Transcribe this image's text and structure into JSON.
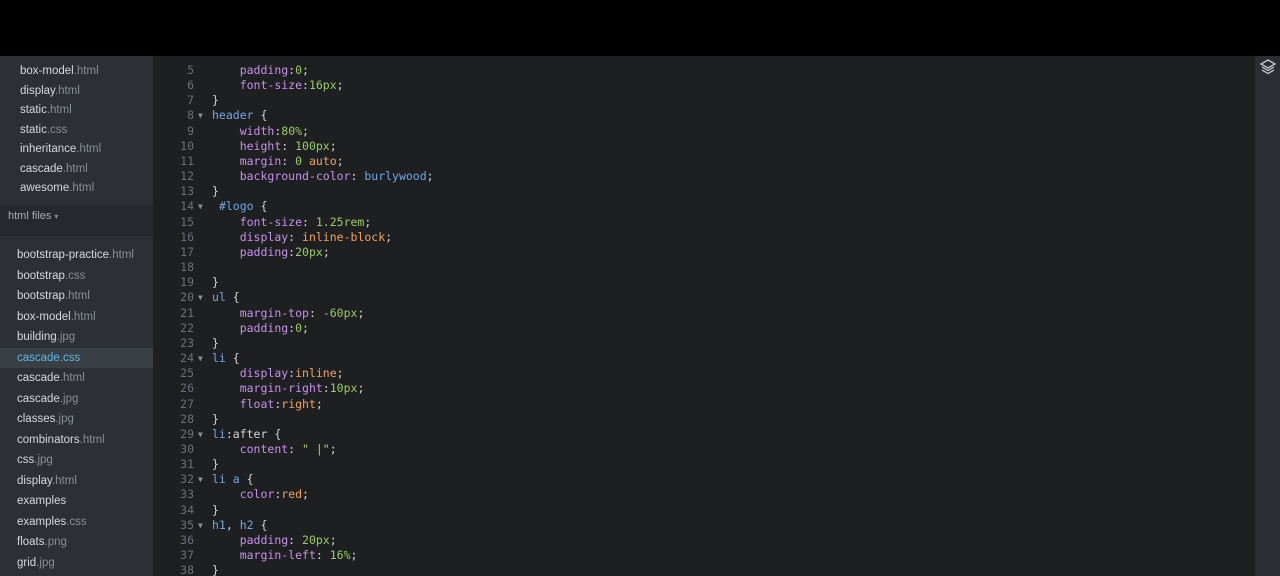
{
  "sidebar": {
    "group1": [
      {
        "name": "box-model",
        "ext": ".html"
      },
      {
        "name": "display",
        "ext": ".html"
      },
      {
        "name": "static",
        "ext": ".html"
      },
      {
        "name": "static",
        "ext": ".css"
      },
      {
        "name": "inheritance",
        "ext": ".html"
      },
      {
        "name": "cascade",
        "ext": ".html"
      },
      {
        "name": "awesome",
        "ext": ".html"
      }
    ],
    "header": "html files",
    "group2": [
      {
        "name": "bootstrap-practice",
        "ext": ".html"
      },
      {
        "name": "bootstrap",
        "ext": ".css"
      },
      {
        "name": "bootstrap",
        "ext": ".html"
      },
      {
        "name": "box-model",
        "ext": ".html"
      },
      {
        "name": "building",
        "ext": ".jpg"
      },
      {
        "name": "cascade",
        "ext": ".css"
      },
      {
        "name": "cascade",
        "ext": ".html"
      },
      {
        "name": "cascade",
        "ext": ".jpg"
      },
      {
        "name": "classes",
        "ext": ".jpg"
      },
      {
        "name": "combinators",
        "ext": ".html"
      },
      {
        "name": "css",
        "ext": ".jpg"
      },
      {
        "name": "display",
        "ext": ".html"
      },
      {
        "name": "examples",
        "ext": ""
      },
      {
        "name": "examples",
        "ext": ".css"
      },
      {
        "name": "floats",
        "ext": ".png"
      },
      {
        "name": "grid",
        "ext": ".jpg"
      }
    ],
    "selected_index": 5
  },
  "editor": {
    "lines": [
      {
        "n": "5",
        "fold": "",
        "tokens": [
          [
            "    ",
            ""
          ],
          [
            "padding",
            "prop"
          ],
          [
            ":",
            "punct"
          ],
          [
            "0",
            "num"
          ],
          [
            ";",
            "punct"
          ]
        ]
      },
      {
        "n": "6",
        "fold": "",
        "tokens": [
          [
            "    ",
            ""
          ],
          [
            "font-size",
            "prop"
          ],
          [
            ":",
            "punct"
          ],
          [
            "16px",
            "num"
          ],
          [
            ";",
            "punct"
          ]
        ]
      },
      {
        "n": "7",
        "fold": "",
        "tokens": [
          [
            "}",
            "punct"
          ]
        ]
      },
      {
        "n": "8",
        "fold": "▼",
        "tokens": [
          [
            "header",
            "sel"
          ],
          [
            " {",
            "punct"
          ]
        ]
      },
      {
        "n": "9",
        "fold": "",
        "tokens": [
          [
            "    ",
            ""
          ],
          [
            "width",
            "prop"
          ],
          [
            ":",
            "punct"
          ],
          [
            "80%",
            "num"
          ],
          [
            ";",
            "punct"
          ]
        ]
      },
      {
        "n": "10",
        "fold": "",
        "tokens": [
          [
            "    ",
            ""
          ],
          [
            "height",
            "prop"
          ],
          [
            ": ",
            "punct"
          ],
          [
            "100px",
            "num"
          ],
          [
            ";",
            "punct"
          ]
        ]
      },
      {
        "n": "11",
        "fold": "",
        "tokens": [
          [
            "    ",
            ""
          ],
          [
            "margin",
            "prop"
          ],
          [
            ": ",
            "punct"
          ],
          [
            "0",
            "num"
          ],
          [
            " ",
            ""
          ],
          [
            "auto",
            "val"
          ],
          [
            ";",
            "punct"
          ]
        ]
      },
      {
        "n": "12",
        "fold": "",
        "tokens": [
          [
            "    ",
            ""
          ],
          [
            "background-color",
            "prop"
          ],
          [
            ": ",
            "punct"
          ],
          [
            "burlywood",
            "sel"
          ],
          [
            ";",
            "punct"
          ]
        ]
      },
      {
        "n": "13",
        "fold": "",
        "tokens": [
          [
            "}",
            "punct"
          ]
        ]
      },
      {
        "n": "14",
        "fold": "▼",
        "tokens": [
          [
            " ",
            ""
          ],
          [
            "#logo",
            "id"
          ],
          [
            " {",
            "punct"
          ]
        ]
      },
      {
        "n": "15",
        "fold": "",
        "tokens": [
          [
            "    ",
            ""
          ],
          [
            "font-size",
            "prop"
          ],
          [
            ": ",
            "punct"
          ],
          [
            "1.25rem",
            "num"
          ],
          [
            ";",
            "punct"
          ]
        ]
      },
      {
        "n": "16",
        "fold": "",
        "tokens": [
          [
            "    ",
            ""
          ],
          [
            "display",
            "prop"
          ],
          [
            ": ",
            "punct"
          ],
          [
            "inline-block",
            "val"
          ],
          [
            ";",
            "punct"
          ]
        ]
      },
      {
        "n": "17",
        "fold": "",
        "tokens": [
          [
            "    ",
            ""
          ],
          [
            "padding",
            "prop"
          ],
          [
            ":",
            "punct"
          ],
          [
            "20px",
            "num"
          ],
          [
            ";",
            "punct"
          ]
        ]
      },
      {
        "n": "18",
        "fold": "",
        "tokens": []
      },
      {
        "n": "19",
        "fold": "",
        "tokens": [
          [
            "}",
            "punct"
          ]
        ]
      },
      {
        "n": "20",
        "fold": "▼",
        "tokens": [
          [
            "ul",
            "sel"
          ],
          [
            " {",
            "punct"
          ]
        ]
      },
      {
        "n": "21",
        "fold": "",
        "tokens": [
          [
            "    ",
            ""
          ],
          [
            "margin-top",
            "prop"
          ],
          [
            ": ",
            "punct"
          ],
          [
            "-60px",
            "num"
          ],
          [
            ";",
            "punct"
          ]
        ]
      },
      {
        "n": "22",
        "fold": "",
        "tokens": [
          [
            "    ",
            ""
          ],
          [
            "padding",
            "prop"
          ],
          [
            ":",
            "punct"
          ],
          [
            "0",
            "num"
          ],
          [
            ";",
            "punct"
          ]
        ]
      },
      {
        "n": "23",
        "fold": "",
        "tokens": [
          [
            "}",
            "punct"
          ]
        ]
      },
      {
        "n": "24",
        "fold": "▼",
        "tokens": [
          [
            "li",
            "sel"
          ],
          [
            " {",
            "punct"
          ]
        ]
      },
      {
        "n": "25",
        "fold": "",
        "tokens": [
          [
            "    ",
            ""
          ],
          [
            "display",
            "prop"
          ],
          [
            ":",
            "punct"
          ],
          [
            "inline",
            "val"
          ],
          [
            ";",
            "punct"
          ]
        ]
      },
      {
        "n": "26",
        "fold": "",
        "tokens": [
          [
            "    ",
            ""
          ],
          [
            "margin-right",
            "prop"
          ],
          [
            ":",
            "punct"
          ],
          [
            "10px",
            "num"
          ],
          [
            ";",
            "punct"
          ]
        ]
      },
      {
        "n": "27",
        "fold": "",
        "tokens": [
          [
            "    ",
            ""
          ],
          [
            "float",
            "prop"
          ],
          [
            ":",
            "punct"
          ],
          [
            "right",
            "val"
          ],
          [
            ";",
            "punct"
          ]
        ]
      },
      {
        "n": "28",
        "fold": "",
        "tokens": [
          [
            "}",
            "punct"
          ]
        ]
      },
      {
        "n": "29",
        "fold": "▼",
        "tokens": [
          [
            "li",
            "sel"
          ],
          [
            ":after {",
            "punct"
          ]
        ]
      },
      {
        "n": "30",
        "fold": "",
        "tokens": [
          [
            "    ",
            ""
          ],
          [
            "content",
            "prop"
          ],
          [
            ": ",
            "punct"
          ],
          [
            "\" |\"",
            "str"
          ],
          [
            ";",
            "punct"
          ]
        ]
      },
      {
        "n": "31",
        "fold": "",
        "tokens": [
          [
            "}",
            "punct"
          ]
        ]
      },
      {
        "n": "32",
        "fold": "▼",
        "tokens": [
          [
            "li a",
            "sel"
          ],
          [
            " {",
            "punct"
          ]
        ]
      },
      {
        "n": "33",
        "fold": "",
        "tokens": [
          [
            "    ",
            ""
          ],
          [
            "color",
            "prop"
          ],
          [
            ":",
            "punct"
          ],
          [
            "red",
            "val"
          ],
          [
            ";",
            "punct"
          ]
        ]
      },
      {
        "n": "34",
        "fold": "",
        "tokens": [
          [
            "}",
            "punct"
          ]
        ]
      },
      {
        "n": "35",
        "fold": "▼",
        "tokens": [
          [
            "h1",
            "sel"
          ],
          [
            ", ",
            "punct"
          ],
          [
            "h2",
            "sel"
          ],
          [
            " {",
            "punct"
          ]
        ]
      },
      {
        "n": "36",
        "fold": "",
        "tokens": [
          [
            "    ",
            ""
          ],
          [
            "padding",
            "prop"
          ],
          [
            ": ",
            "punct"
          ],
          [
            "20px",
            "num"
          ],
          [
            ";",
            "punct"
          ]
        ]
      },
      {
        "n": "37",
        "fold": "",
        "tokens": [
          [
            "    ",
            ""
          ],
          [
            "margin-left",
            "prop"
          ],
          [
            ": ",
            "punct"
          ],
          [
            "16%",
            "num"
          ],
          [
            ";",
            "punct"
          ]
        ]
      },
      {
        "n": "38",
        "fold": "",
        "tokens": [
          [
            "}",
            "punct"
          ]
        ]
      }
    ]
  },
  "colors": {
    "sidebar_bg": "#2c2f33",
    "editor_bg": "#1d1f21",
    "selected_file": "#59b7e8",
    "selector": "#6fa8e8",
    "property": "#c792ea",
    "value_keyword": "#f0a35e",
    "number": "#9ccc65"
  },
  "icons": {
    "layers": "layers-icon"
  }
}
